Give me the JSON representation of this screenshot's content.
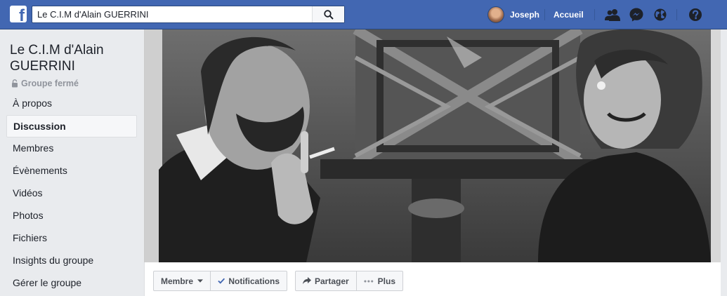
{
  "header": {
    "logo_letter": "f",
    "search": {
      "value": "Le C.I.M d'Alain GUERRINI"
    },
    "user_name": "Joseph",
    "home_label": "Accueil",
    "icons": [
      "search-icon",
      "friend-requests-icon",
      "messenger-icon",
      "notifications-globe-icon",
      "help-icon"
    ]
  },
  "group": {
    "title": "Le C.I.M d'Alain GUERRINI",
    "privacy": "Groupe fermé"
  },
  "sidebar": {
    "items": [
      {
        "label": "À propos"
      },
      {
        "label": "Discussion",
        "active": true
      },
      {
        "label": "Membres"
      },
      {
        "label": "Évènements"
      },
      {
        "label": "Vidéos"
      },
      {
        "label": "Photos"
      },
      {
        "label": "Fichiers"
      },
      {
        "label": "Insights du groupe"
      },
      {
        "label": "Gérer le groupe"
      }
    ]
  },
  "actions": {
    "member": "Membre",
    "notifications": "Notifications",
    "share": "Partager",
    "more": "Plus"
  },
  "colors": {
    "brand": "#4267b2",
    "page_bg": "#e9ebee",
    "link": "#4b4f56"
  }
}
